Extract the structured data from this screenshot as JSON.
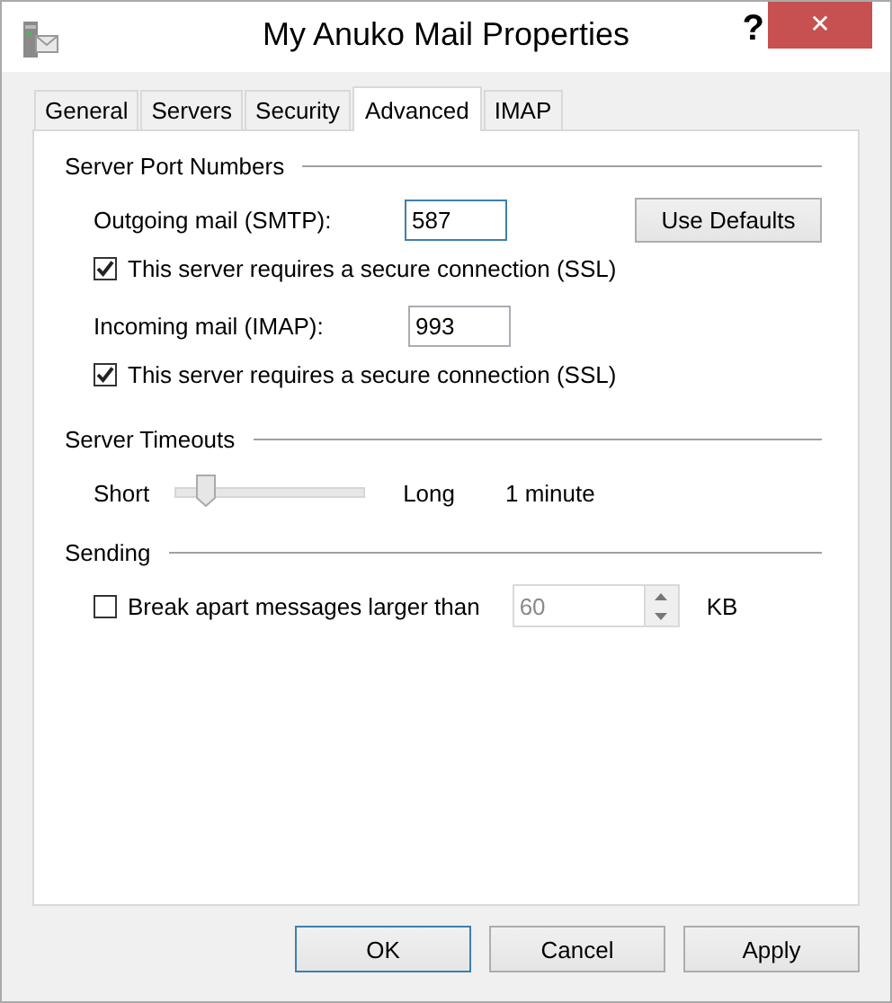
{
  "window": {
    "title": "My Anuko Mail Properties",
    "help": "?",
    "close": "✕"
  },
  "tabs": [
    {
      "label": "General",
      "selected": false
    },
    {
      "label": "Servers",
      "selected": false
    },
    {
      "label": "Security",
      "selected": false
    },
    {
      "label": "Advanced",
      "selected": true
    },
    {
      "label": "IMAP",
      "selected": false
    }
  ],
  "port_group": {
    "title": "Server Port Numbers",
    "outgoing": {
      "label": "Outgoing mail (SMTP):",
      "value": "587",
      "focused": true
    },
    "use_defaults": {
      "label": "Use Defaults"
    },
    "outgoing_ssl": {
      "label": "This server requires a secure connection (SSL)",
      "checked": true
    },
    "incoming": {
      "label": "Incoming mail (IMAP):",
      "value": "993",
      "focused": false
    },
    "incoming_ssl": {
      "label": "This server requires a secure connection (SSL)",
      "checked": true
    }
  },
  "timeout_group": {
    "title": "Server Timeouts",
    "min_label": "Short",
    "max_label": "Long",
    "level": 0.15,
    "reading": "1 minute"
  },
  "sending_group": {
    "title": "Sending",
    "break_apart": {
      "label": "Break apart messages larger than",
      "checked": false
    },
    "size": {
      "value": "60",
      "disabled": true
    },
    "unit": "KB"
  },
  "buttons": [
    {
      "label": "OK",
      "default": true
    },
    {
      "label": "Cancel",
      "default": false
    },
    {
      "label": "Apply",
      "default": false
    }
  ]
}
